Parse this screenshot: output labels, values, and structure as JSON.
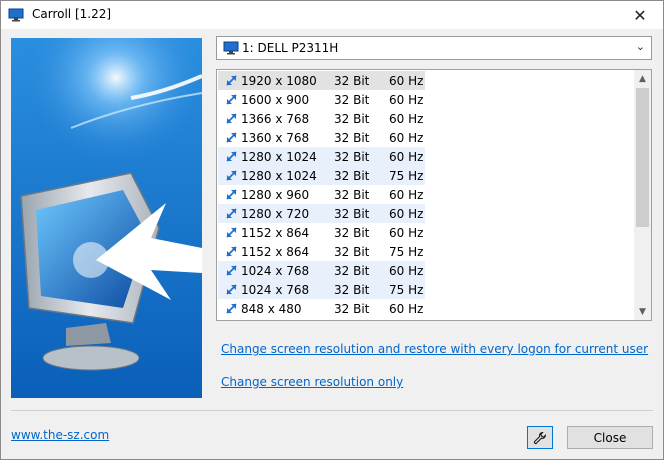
{
  "window": {
    "title": "Carroll [1.22]",
    "close_glyph": "✕"
  },
  "monitor_select": {
    "value": "1: DELL P2311H",
    "chevron": "⌄"
  },
  "resolutions": [
    {
      "res": "1920 x 1080",
      "bits": "32 Bit",
      "hz": "60 Hz"
    },
    {
      "res": "1600 x 900",
      "bits": "32 Bit",
      "hz": "60 Hz"
    },
    {
      "res": "1366 x 768",
      "bits": "32 Bit",
      "hz": "60 Hz"
    },
    {
      "res": "1360 x 768",
      "bits": "32 Bit",
      "hz": "60 Hz"
    },
    {
      "res": "1280 x 1024",
      "bits": "32 Bit",
      "hz": "60 Hz"
    },
    {
      "res": "1280 x 1024",
      "bits": "32 Bit",
      "hz": "75 Hz"
    },
    {
      "res": "1280 x 960",
      "bits": "32 Bit",
      "hz": "60 Hz"
    },
    {
      "res": "1280 x 720",
      "bits": "32 Bit",
      "hz": "60 Hz"
    },
    {
      "res": "1152 x 864",
      "bits": "32 Bit",
      "hz": "60 Hz"
    },
    {
      "res": "1152 x 864",
      "bits": "32 Bit",
      "hz": "75 Hz"
    },
    {
      "res": "1024 x 768",
      "bits": "32 Bit",
      "hz": "60 Hz"
    },
    {
      "res": "1024 x 768",
      "bits": "32 Bit",
      "hz": "75 Hz"
    },
    {
      "res": "848 x 480",
      "bits": "32 Bit",
      "hz": "60 Hz"
    }
  ],
  "links": {
    "restore_logon": "Change screen resolution and restore with every logon for current user",
    "only": "Change screen resolution only",
    "website": "www.the-sz.com"
  },
  "buttons": {
    "close": "Close"
  },
  "colors": {
    "accent": "#0078d7",
    "link": "#0066cc",
    "row_shade": "#e8f0fb"
  }
}
